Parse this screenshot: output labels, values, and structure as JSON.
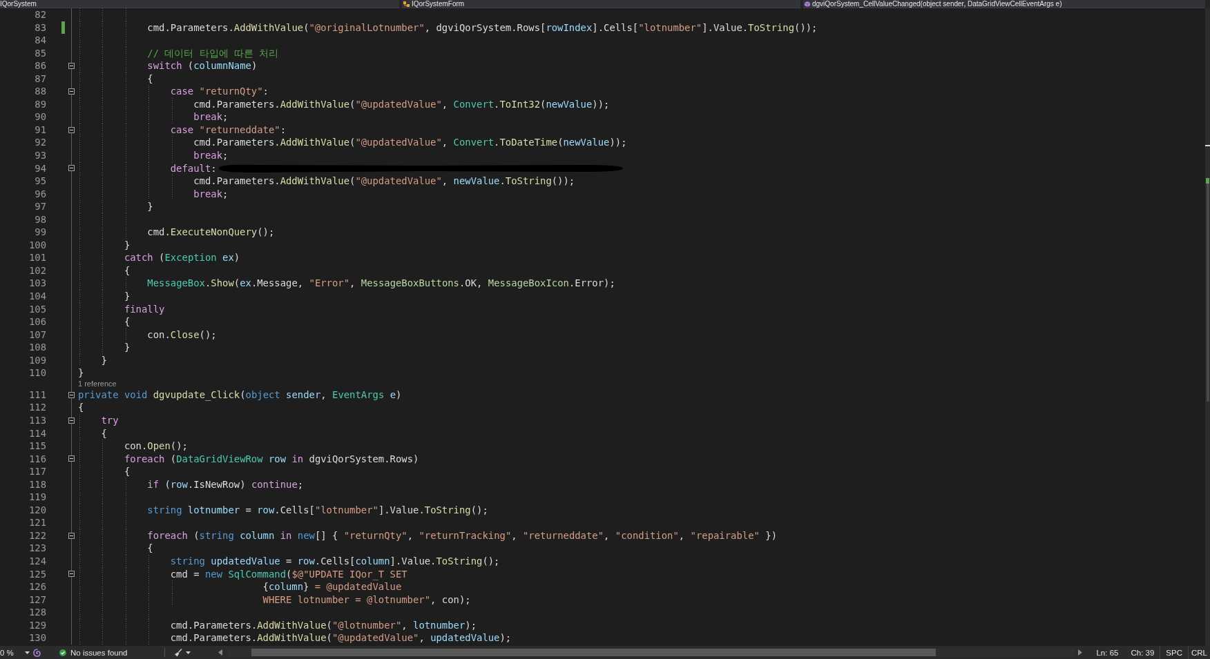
{
  "navigation_bar": [
    {
      "kind": "project",
      "label": "IQorSystem"
    },
    {
      "kind": "class",
      "label": "IQorSystemForm"
    },
    {
      "kind": "member",
      "label": "dgviQorSystem_CellValueChanged(object sender, DataGridViewCellEventArgs e)"
    }
  ],
  "editor": {
    "lines": [
      {
        "number": "82",
        "modified": false
      },
      {
        "number": "83",
        "modified": true,
        "tokens": [
          {
            "text": "            cmd.Parameters.",
            "kind": "plain"
          },
          {
            "text": "AddWithValue",
            "kind": "method"
          },
          {
            "text": "(",
            "kind": "plain"
          },
          {
            "text": "\"@originalLotnumber\"",
            "kind": "string"
          },
          {
            "text": ", dgviQorSystem.Rows[",
            "kind": "plain"
          },
          {
            "text": "rowIndex",
            "kind": "variable"
          },
          {
            "text": "].Cells[",
            "kind": "plain"
          },
          {
            "text": "\"lotnumber\"",
            "kind": "string"
          },
          {
            "text": "].Value.",
            "kind": "plain"
          },
          {
            "text": "ToString",
            "kind": "method"
          },
          {
            "text": "());",
            "kind": "plain"
          }
        ]
      },
      {
        "number": "84",
        "modified": false
      },
      {
        "number": "85",
        "modified": false,
        "tokens": [
          {
            "text": "            // 데이터 타입에 따른 처리",
            "kind": "comment"
          }
        ]
      },
      {
        "number": "86",
        "modified": false,
        "fold": {
          "expanded": true
        },
        "tokens": [
          {
            "text": "            switch",
            "kind": "control"
          },
          {
            "text": " (",
            "kind": "plain"
          },
          {
            "text": "columnName",
            "kind": "variable"
          },
          {
            "text": ")",
            "kind": "plain"
          }
        ]
      },
      {
        "number": "87",
        "modified": false,
        "tokens": [
          {
            "text": "            {",
            "kind": "plain"
          }
        ]
      },
      {
        "number": "88",
        "modified": false,
        "fold": {
          "expanded": true
        },
        "tokens": [
          {
            "text": "                case",
            "kind": "control"
          },
          {
            "text": " \"returnQty\"",
            "kind": "string"
          },
          {
            "text": ":",
            "kind": "plain"
          }
        ]
      },
      {
        "number": "89",
        "modified": false,
        "tokens": [
          {
            "text": "                    cmd.Parameters.",
            "kind": "plain"
          },
          {
            "text": "AddWithValue",
            "kind": "method"
          },
          {
            "text": "(",
            "kind": "plain"
          },
          {
            "text": "\"@updatedValue\"",
            "kind": "string"
          },
          {
            "text": ", ",
            "kind": "plain"
          },
          {
            "text": "Convert",
            "kind": "type"
          },
          {
            "text": ".",
            "kind": "plain"
          },
          {
            "text": "ToInt32",
            "kind": "method"
          },
          {
            "text": "(",
            "kind": "plain"
          },
          {
            "text": "newValue",
            "kind": "variable"
          },
          {
            "text": "));",
            "kind": "plain"
          }
        ]
      },
      {
        "number": "90",
        "modified": false,
        "tokens": [
          {
            "text": "                    break",
            "kind": "control"
          },
          {
            "text": ";",
            "kind": "plain"
          }
        ]
      },
      {
        "number": "91",
        "modified": false,
        "fold": {
          "expanded": true
        },
        "tokens": [
          {
            "text": "                case",
            "kind": "control"
          },
          {
            "text": " \"returneddate\"",
            "kind": "string"
          },
          {
            "text": ":",
            "kind": "plain"
          }
        ]
      },
      {
        "number": "92",
        "modified": false,
        "tokens": [
          {
            "text": "                    cmd.Parameters.",
            "kind": "plain"
          },
          {
            "text": "AddWithValue",
            "kind": "method"
          },
          {
            "text": "(",
            "kind": "plain"
          },
          {
            "text": "\"@updatedValue\"",
            "kind": "string"
          },
          {
            "text": ", ",
            "kind": "plain"
          },
          {
            "text": "Convert",
            "kind": "type"
          },
          {
            "text": ".",
            "kind": "plain"
          },
          {
            "text": "ToDateTime",
            "kind": "method"
          },
          {
            "text": "(",
            "kind": "plain"
          },
          {
            "text": "newValue",
            "kind": "variable"
          },
          {
            "text": "));",
            "kind": "plain"
          }
        ]
      },
      {
        "number": "93",
        "modified": false,
        "tokens": [
          {
            "text": "                    break",
            "kind": "control"
          },
          {
            "text": ";",
            "kind": "plain"
          }
        ]
      },
      {
        "number": "94",
        "modified": false,
        "fold": {
          "expanded": true
        },
        "tokens": [
          {
            "text": "                default",
            "kind": "control"
          },
          {
            "text": ":",
            "kind": "plain"
          },
          {
            "kind": "redaction"
          }
        ]
      },
      {
        "number": "95",
        "modified": false,
        "tokens": [
          {
            "text": "                    cmd.Parameters.",
            "kind": "plain"
          },
          {
            "text": "AddWithValue",
            "kind": "method"
          },
          {
            "text": "(",
            "kind": "plain"
          },
          {
            "text": "\"@updatedValue\"",
            "kind": "string"
          },
          {
            "text": ", ",
            "kind": "plain"
          },
          {
            "text": "newValue",
            "kind": "variable"
          },
          {
            "text": ".",
            "kind": "plain"
          },
          {
            "text": "ToString",
            "kind": "method"
          },
          {
            "text": "());",
            "kind": "plain"
          }
        ]
      },
      {
        "number": "96",
        "modified": false,
        "tokens": [
          {
            "text": "                    break",
            "kind": "control"
          },
          {
            "text": ";",
            "kind": "plain"
          }
        ]
      },
      {
        "number": "97",
        "modified": false,
        "tokens": [
          {
            "text": "            }",
            "kind": "plain"
          }
        ]
      },
      {
        "number": "98",
        "modified": false
      },
      {
        "number": "99",
        "modified": false,
        "tokens": [
          {
            "text": "            cmd.",
            "kind": "plain"
          },
          {
            "text": "ExecuteNonQuery",
            "kind": "method"
          },
          {
            "text": "();",
            "kind": "plain"
          }
        ]
      },
      {
        "number": "100",
        "modified": false,
        "tokens": [
          {
            "text": "        }",
            "kind": "plain"
          }
        ]
      },
      {
        "number": "101",
        "modified": false,
        "tokens": [
          {
            "text": "        catch",
            "kind": "control"
          },
          {
            "text": " (",
            "kind": "plain"
          },
          {
            "text": "Exception",
            "kind": "type"
          },
          {
            "text": " ex",
            "kind": "variable"
          },
          {
            "text": ")",
            "kind": "plain"
          }
        ]
      },
      {
        "number": "102",
        "modified": false,
        "tokens": [
          {
            "text": "        {",
            "kind": "plain"
          }
        ]
      },
      {
        "number": "103",
        "modified": false,
        "tokens": [
          {
            "text": "            MessageBox",
            "kind": "type"
          },
          {
            "text": ".",
            "kind": "plain"
          },
          {
            "text": "Show",
            "kind": "method"
          },
          {
            "text": "(",
            "kind": "plain"
          },
          {
            "text": "ex",
            "kind": "variable"
          },
          {
            "text": ".Message, ",
            "kind": "plain"
          },
          {
            "text": "\"Error\"",
            "kind": "string"
          },
          {
            "text": ", ",
            "kind": "plain"
          },
          {
            "text": "MessageBoxButtons",
            "kind": "enum"
          },
          {
            "text": ".OK, ",
            "kind": "plain"
          },
          {
            "text": "MessageBoxIcon",
            "kind": "enum"
          },
          {
            "text": ".Error);",
            "kind": "plain"
          }
        ]
      },
      {
        "number": "104",
        "modified": false,
        "tokens": [
          {
            "text": "        }",
            "kind": "plain"
          }
        ]
      },
      {
        "number": "105",
        "modified": false,
        "tokens": [
          {
            "text": "        finally",
            "kind": "control"
          }
        ]
      },
      {
        "number": "106",
        "modified": false,
        "tokens": [
          {
            "text": "        {",
            "kind": "plain"
          }
        ]
      },
      {
        "number": "107",
        "modified": false,
        "tokens": [
          {
            "text": "            con.",
            "kind": "plain"
          },
          {
            "text": "Close",
            "kind": "method"
          },
          {
            "text": "();",
            "kind": "plain"
          }
        ]
      },
      {
        "number": "108",
        "modified": false,
        "tokens": [
          {
            "text": "        }",
            "kind": "plain"
          }
        ]
      },
      {
        "number": "109",
        "modified": false,
        "tokens": [
          {
            "text": "    }",
            "kind": "plain"
          }
        ]
      },
      {
        "number": "110",
        "modified": false,
        "tokens": [
          {
            "text": "}",
            "kind": "plain"
          }
        ]
      },
      {
        "number": "111",
        "modified": false,
        "fold": {
          "expanded": true
        },
        "codelens": "1 reference",
        "tokens": [
          {
            "text": "private void",
            "kind": "keyword"
          },
          {
            "text": " dgvupdate_Click",
            "kind": "method"
          },
          {
            "text": "(",
            "kind": "plain"
          },
          {
            "text": "object",
            "kind": "keyword"
          },
          {
            "text": " sender",
            "kind": "variable"
          },
          {
            "text": ", ",
            "kind": "plain"
          },
          {
            "text": "EventArgs",
            "kind": "type"
          },
          {
            "text": " e",
            "kind": "variable"
          },
          {
            "text": ")",
            "kind": "plain"
          }
        ]
      },
      {
        "number": "112",
        "modified": false,
        "tokens": [
          {
            "text": "{",
            "kind": "plain"
          }
        ]
      },
      {
        "number": "113",
        "modified": false,
        "fold": {
          "expanded": true
        },
        "tokens": [
          {
            "text": "    try",
            "kind": "control"
          }
        ]
      },
      {
        "number": "114",
        "modified": false,
        "tokens": [
          {
            "text": "    {",
            "kind": "plain"
          }
        ]
      },
      {
        "number": "115",
        "modified": false,
        "tokens": [
          {
            "text": "        con.",
            "kind": "plain"
          },
          {
            "text": "Open",
            "kind": "method"
          },
          {
            "text": "();",
            "kind": "plain"
          }
        ]
      },
      {
        "number": "116",
        "modified": false,
        "fold": {
          "expanded": true
        },
        "tokens": [
          {
            "text": "        foreach",
            "kind": "control"
          },
          {
            "text": " (",
            "kind": "plain"
          },
          {
            "text": "DataGridViewRow",
            "kind": "type"
          },
          {
            "text": " row",
            "kind": "variable"
          },
          {
            "text": " in",
            "kind": "control"
          },
          {
            "text": " dgviQorSystem.Rows)",
            "kind": "plain"
          }
        ]
      },
      {
        "number": "117",
        "modified": false,
        "tokens": [
          {
            "text": "        {",
            "kind": "plain"
          }
        ]
      },
      {
        "number": "118",
        "modified": false,
        "tokens": [
          {
            "text": "            if",
            "kind": "control"
          },
          {
            "text": " (",
            "kind": "plain"
          },
          {
            "text": "row",
            "kind": "variable"
          },
          {
            "text": ".IsNewRow) ",
            "kind": "plain"
          },
          {
            "text": "continue",
            "kind": "control"
          },
          {
            "text": ";",
            "kind": "plain"
          }
        ]
      },
      {
        "number": "119",
        "modified": false
      },
      {
        "number": "120",
        "modified": false,
        "tokens": [
          {
            "text": "            string",
            "kind": "keyword"
          },
          {
            "text": " lotnumber",
            "kind": "variable"
          },
          {
            "text": " = ",
            "kind": "plain"
          },
          {
            "text": "row",
            "kind": "variable"
          },
          {
            "text": ".Cells[",
            "kind": "plain"
          },
          {
            "text": "\"lotnumber\"",
            "kind": "string"
          },
          {
            "text": "].Value.",
            "kind": "plain"
          },
          {
            "text": "ToString",
            "kind": "method"
          },
          {
            "text": "();",
            "kind": "plain"
          }
        ]
      },
      {
        "number": "121",
        "modified": false
      },
      {
        "number": "122",
        "modified": false,
        "fold": {
          "expanded": true
        },
        "tokens": [
          {
            "text": "            foreach",
            "kind": "control"
          },
          {
            "text": " (",
            "kind": "plain"
          },
          {
            "text": "string",
            "kind": "keyword"
          },
          {
            "text": " column",
            "kind": "variable"
          },
          {
            "text": " in",
            "kind": "control"
          },
          {
            "text": " new",
            "kind": "keyword"
          },
          {
            "text": "[] { ",
            "kind": "plain"
          },
          {
            "text": "\"returnQty\"",
            "kind": "string"
          },
          {
            "text": ", ",
            "kind": "plain"
          },
          {
            "text": "\"returnTracking\"",
            "kind": "string"
          },
          {
            "text": ", ",
            "kind": "plain"
          },
          {
            "text": "\"returneddate\"",
            "kind": "string"
          },
          {
            "text": ", ",
            "kind": "plain"
          },
          {
            "text": "\"condition\"",
            "kind": "string"
          },
          {
            "text": ", ",
            "kind": "plain"
          },
          {
            "text": "\"repairable\"",
            "kind": "string"
          },
          {
            "text": " })",
            "kind": "plain"
          }
        ]
      },
      {
        "number": "123",
        "modified": false,
        "tokens": [
          {
            "text": "            {",
            "kind": "plain"
          }
        ]
      },
      {
        "number": "124",
        "modified": false,
        "tokens": [
          {
            "text": "                string",
            "kind": "keyword"
          },
          {
            "text": " updatedValue",
            "kind": "variable"
          },
          {
            "text": " = ",
            "kind": "plain"
          },
          {
            "text": "row",
            "kind": "variable"
          },
          {
            "text": ".Cells[",
            "kind": "plain"
          },
          {
            "text": "column",
            "kind": "variable"
          },
          {
            "text": "].Value.",
            "kind": "plain"
          },
          {
            "text": "ToString",
            "kind": "method"
          },
          {
            "text": "();",
            "kind": "plain"
          }
        ]
      },
      {
        "number": "125",
        "modified": false,
        "fold": {
          "expanded": true
        },
        "tokens": [
          {
            "text": "                cmd = ",
            "kind": "plain"
          },
          {
            "text": "new",
            "kind": "keyword"
          },
          {
            "text": " SqlCommand",
            "kind": "type"
          },
          {
            "text": "(",
            "kind": "plain"
          },
          {
            "text": "$@\"UPDATE IQor_T SET",
            "kind": "string"
          }
        ]
      },
      {
        "number": "126",
        "modified": false,
        "tokens": [
          {
            "text": "                                {",
            "kind": "plain"
          },
          {
            "text": "column",
            "kind": "variable"
          },
          {
            "text": "}",
            "kind": "plain"
          },
          {
            "text": " = @updatedValue",
            "kind": "string"
          }
        ]
      },
      {
        "number": "127",
        "modified": false,
        "tokens": [
          {
            "text": "                                WHERE lotnumber = @lotnumber\"",
            "kind": "string"
          },
          {
            "text": ", con);",
            "kind": "plain"
          }
        ]
      },
      {
        "number": "128",
        "modified": false
      },
      {
        "number": "129",
        "modified": false,
        "tokens": [
          {
            "text": "                cmd.Parameters.",
            "kind": "plain"
          },
          {
            "text": "AddWithValue",
            "kind": "method"
          },
          {
            "text": "(",
            "kind": "plain"
          },
          {
            "text": "\"@lotnumber\"",
            "kind": "string"
          },
          {
            "text": ", ",
            "kind": "plain"
          },
          {
            "text": "lotnumber",
            "kind": "variable"
          },
          {
            "text": ");",
            "kind": "plain"
          }
        ]
      },
      {
        "number": "130",
        "modified": false,
        "tokens": [
          {
            "text": "                cmd.Parameters.",
            "kind": "plain"
          },
          {
            "text": "AddWithValue",
            "kind": "method"
          },
          {
            "text": "(",
            "kind": "plain"
          },
          {
            "text": "\"@updatedValue\"",
            "kind": "string"
          },
          {
            "text": ", ",
            "kind": "plain"
          },
          {
            "text": "updatedValue",
            "kind": "variable"
          },
          {
            "text": ");",
            "kind": "plain"
          }
        ]
      }
    ]
  },
  "status_bar": {
    "zoom": "0 %",
    "issues": "No issues found",
    "line": "Ln: 65",
    "column": "Ch: 39",
    "whitespace": "SPC",
    "line_endings": "CRL"
  }
}
